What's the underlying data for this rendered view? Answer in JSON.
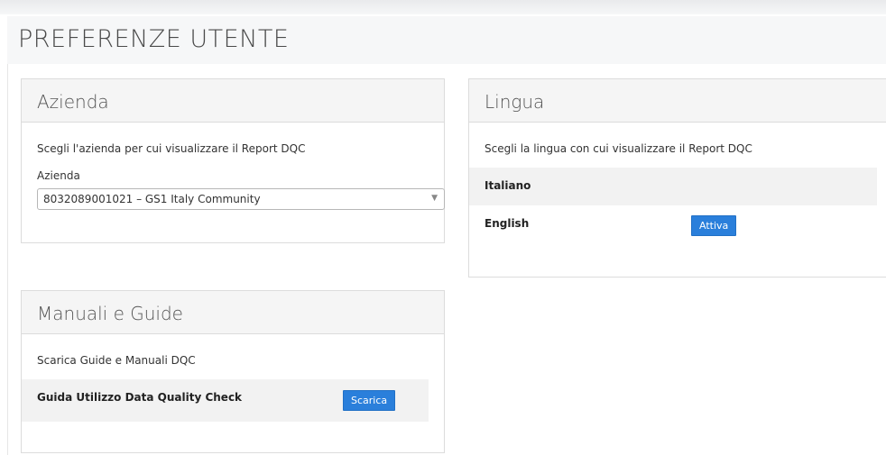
{
  "page": {
    "title": "PREFERENZE UTENTE"
  },
  "azienda": {
    "heading": "Azienda",
    "description": "Scegli l'azienda per cui visualizzare il Report DQC",
    "field_label": "Azienda",
    "selected_value": "8032089001021 – GS1 Italy Community"
  },
  "lingua": {
    "heading": "Lingua",
    "description": "Scegli la lingua con cui visualizzare il Report DQC",
    "languages": [
      {
        "name": "Italiano",
        "action": ""
      },
      {
        "name": "English",
        "action": "Attiva"
      }
    ]
  },
  "manuali": {
    "heading": "Manuali e Guide",
    "description": "Scarica Guide e Manuali DQC",
    "items": [
      {
        "name": "Guida Utilizzo Data Quality Check",
        "action": "Scarica"
      }
    ]
  },
  "colors": {
    "accent": "#2a7fdb",
    "panel_header": "#f5f5f5",
    "row_shade": "#f2f2f2"
  },
  "icons": {
    "select_caret": "caret-down-icon"
  }
}
